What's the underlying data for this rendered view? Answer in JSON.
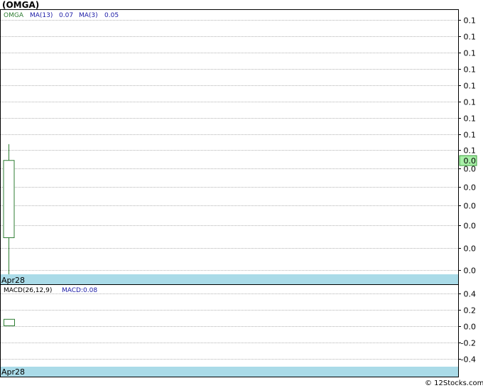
{
  "colors": {
    "up_candle": "#2e7d32",
    "legend_symbol": "#2e7d32",
    "legend_ma": "#1a1aa6",
    "date_bar": "#aadbe8",
    "last_price_box": "#a8f0a8",
    "grid": "#9a9a9a"
  },
  "title": "(OMGA)",
  "credit": "© 12Stocks.com",
  "chart_data": [
    {
      "type": "candlestick",
      "legend": {
        "symbol": "OMGA",
        "ma13_label": "MA(13)",
        "ma13_value": "0.07",
        "ma3_label": "MA(3)",
        "ma3_value": "0.05"
      },
      "y_tick_labels": [
        "0.1",
        "0.1",
        "0.1",
        "0.1",
        "0.1",
        "0.1",
        "0.1",
        "0.1",
        "0.1",
        "0.0",
        "0.0",
        "0.0",
        "0.0",
        "0.0",
        "0.0"
      ],
      "y_tick_values": [
        0.153,
        0.145,
        0.137,
        0.129,
        0.121,
        0.113,
        0.105,
        0.097,
        0.089,
        0.08,
        0.071,
        0.062,
        0.052,
        0.041,
        0.03
      ],
      "last_price_label": "0.0",
      "last_price_value": 0.084,
      "ylim": [
        0.028,
        0.158
      ],
      "x_labels": [
        "Apr28"
      ],
      "candles": [
        {
          "date": "Apr28",
          "open": 0.046,
          "high": 0.092,
          "low": 0.028,
          "close": 0.084
        }
      ],
      "grid": true
    },
    {
      "type": "bar",
      "legend": {
        "label": "MACD(26,12,9)",
        "macd_label": "MACD:0.08"
      },
      "y_tick_labels": [
        "0.4",
        "0.2",
        "0.0",
        "-0.2",
        "-0.4"
      ],
      "y_tick_values": [
        0.4,
        0.2,
        0.0,
        -0.2,
        -0.4
      ],
      "ylim": [
        -0.5,
        0.5
      ],
      "x_labels": [
        "Apr28"
      ],
      "values": [
        0.08
      ],
      "grid": true
    }
  ]
}
